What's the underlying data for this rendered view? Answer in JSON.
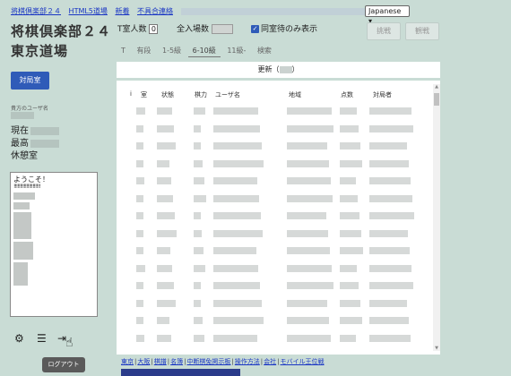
{
  "top_links": [
    "将棋倶楽部２４",
    "HTML5道場",
    "新着",
    "不具合連絡"
  ],
  "language": "Japanese",
  "site_title": "将棋倶楽部２４",
  "dojo_name": "東京道場",
  "match_button": "対局室",
  "side": {
    "label": "貴方のユーザ名",
    "current": "現在",
    "highest": "最高",
    "lounge": "休憩室"
  },
  "chat": {
    "greeting": "ようこそ！",
    "marks": "!!!!!!!!!!!!!!!!!!!!!"
  },
  "tooltip": "ログアウト",
  "header": {
    "t_rooms_label": "T室人数",
    "t_rooms_value": "0",
    "all_rooms_label": "全入場数",
    "waiting_only_label": "同室待のみ表示",
    "watch_button": "挑戦",
    "view_button": "観戦"
  },
  "tabs": [
    "T",
    "有段",
    "1-5級",
    "6-10級",
    "11級-",
    "検索"
  ],
  "active_tab": "6-10級",
  "update": {
    "prefix": "更新（",
    "suffix": "）"
  },
  "columns": [
    "i",
    "室",
    "状態",
    "棋力",
    "ユーザ名",
    "地域",
    "点数",
    "対局者"
  ],
  "bottom_links": [
    "東京",
    "大阪",
    "棋譜",
    "名簿",
    "中断棋免掲示板",
    "操作方法",
    "会社",
    "モバイル王位戦"
  ],
  "icons": [
    "gear-icon",
    "list-icon",
    "logout-icon",
    "pointer-cursor-icon",
    "checkbox-checked-icon"
  ]
}
